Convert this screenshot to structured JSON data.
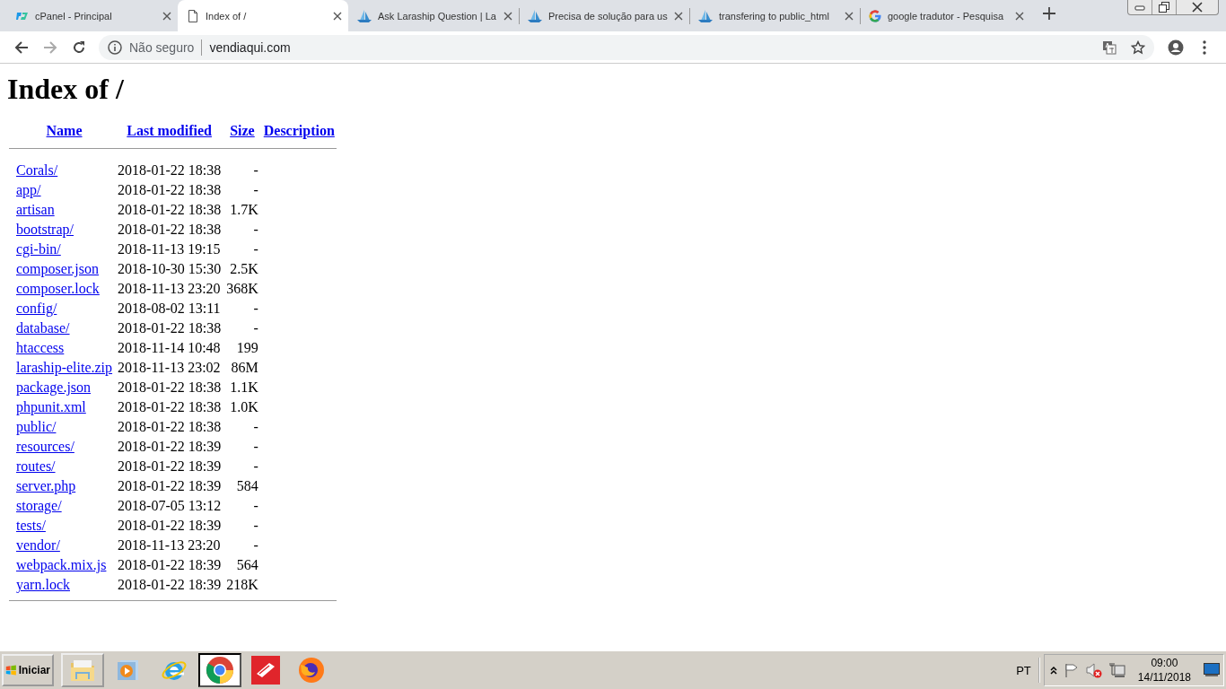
{
  "tabs": [
    {
      "kind": "cpanel",
      "title": "cPanel - Principal",
      "selected": false
    },
    {
      "kind": "page",
      "title": "Index of /",
      "selected": true
    },
    {
      "kind": "laraship",
      "title": "Ask Laraship Question | La",
      "selected": false
    },
    {
      "kind": "laraship",
      "title": "Precisa de solução para us",
      "selected": false
    },
    {
      "kind": "laraship",
      "title": "transfering to public_html",
      "selected": false
    },
    {
      "kind": "google",
      "title": "google tradutor - Pesquisa",
      "selected": false
    }
  ],
  "address_bar": {
    "security": "Não seguro",
    "url": "vendiaqui.com"
  },
  "page": {
    "heading": "Index of /",
    "columns": [
      "Name",
      "Last modified",
      "Size",
      "Description"
    ],
    "rows": [
      {
        "name": "Corals/",
        "modified": "2018-01-22 18:38",
        "size": "-"
      },
      {
        "name": "app/",
        "modified": "2018-01-22 18:38",
        "size": "-"
      },
      {
        "name": "artisan",
        "modified": "2018-01-22 18:38",
        "size": "1.7K"
      },
      {
        "name": "bootstrap/",
        "modified": "2018-01-22 18:38",
        "size": "-"
      },
      {
        "name": "cgi-bin/",
        "modified": "2018-11-13 19:15",
        "size": "-"
      },
      {
        "name": "composer.json",
        "modified": "2018-10-30 15:30",
        "size": "2.5K"
      },
      {
        "name": "composer.lock",
        "modified": "2018-11-13 23:20",
        "size": "368K"
      },
      {
        "name": "config/",
        "modified": "2018-08-02 13:11",
        "size": "-"
      },
      {
        "name": "database/",
        "modified": "2018-01-22 18:38",
        "size": "-"
      },
      {
        "name": "htaccess",
        "modified": "2018-11-14 10:48",
        "size": "199"
      },
      {
        "name": "laraship-elite.zip",
        "modified": "2018-11-13 23:02",
        "size": "86M"
      },
      {
        "name": "package.json",
        "modified": "2018-01-22 18:38",
        "size": "1.1K"
      },
      {
        "name": "phpunit.xml",
        "modified": "2018-01-22 18:38",
        "size": "1.0K"
      },
      {
        "name": "public/",
        "modified": "2018-01-22 18:38",
        "size": "-"
      },
      {
        "name": "resources/",
        "modified": "2018-01-22 18:39",
        "size": "-"
      },
      {
        "name": "routes/",
        "modified": "2018-01-22 18:39",
        "size": "-"
      },
      {
        "name": "server.php",
        "modified": "2018-01-22 18:39",
        "size": "584"
      },
      {
        "name": "storage/",
        "modified": "2018-07-05 13:12",
        "size": "-"
      },
      {
        "name": "tests/",
        "modified": "2018-01-22 18:39",
        "size": "-"
      },
      {
        "name": "vendor/",
        "modified": "2018-11-13 23:20",
        "size": "-"
      },
      {
        "name": "webpack.mix.js",
        "modified": "2018-01-22 18:39",
        "size": "564"
      },
      {
        "name": "yarn.lock",
        "modified": "2018-01-22 18:39",
        "size": "218K"
      }
    ]
  },
  "taskbar": {
    "start": "Iniciar",
    "apps": [
      {
        "kind": "folder",
        "selected": false
      },
      {
        "kind": "media",
        "selected": false
      },
      {
        "kind": "ie",
        "selected": false
      },
      {
        "kind": "chrome",
        "selected": true
      },
      {
        "kind": "card",
        "selected": false
      },
      {
        "kind": "firefox",
        "selected": false
      }
    ],
    "language": "PT",
    "time": "09:00",
    "date": "14/11/2018"
  }
}
